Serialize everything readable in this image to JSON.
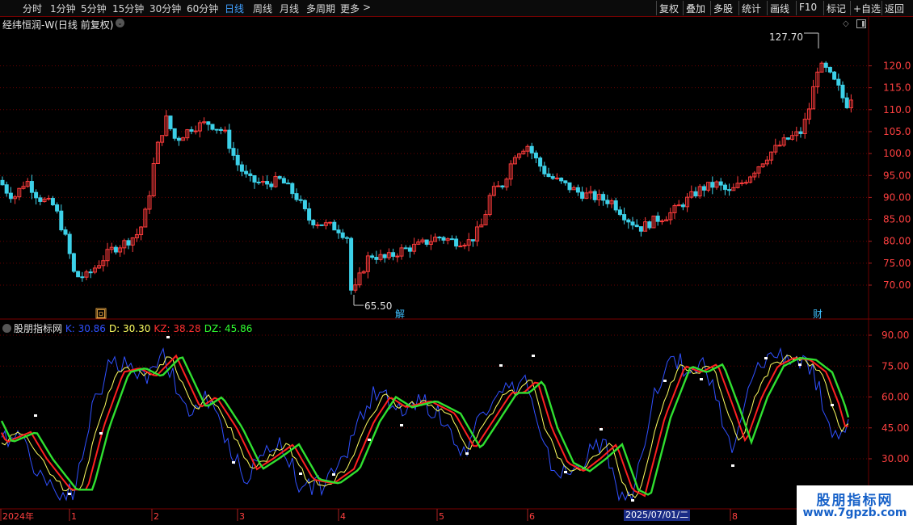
{
  "toolbar": {
    "periods": [
      "分时",
      "1分钟",
      "5分钟",
      "15分钟",
      "30分钟",
      "60分钟",
      "日线",
      "周线",
      "月线",
      "多周期",
      "更多"
    ],
    "active_period": "日线",
    "more_arrow": ">",
    "right_buttons": [
      "复权",
      "叠加",
      "多股",
      "统计",
      "画线",
      "F10",
      "标记",
      "+自选",
      "返回"
    ]
  },
  "main_chart": {
    "title": "经纬恒润-W(日线 前复权)",
    "price_ticks": [
      "120.0",
      "115.0",
      "110.0",
      "105.0",
      "100.0",
      "95.00",
      "90.00",
      "85.00",
      "80.00",
      "75.00",
      "70.00"
    ],
    "high_label": "127.70",
    "low_label": "65.50",
    "markers": [
      {
        "text": "回",
        "color": "#e0a040"
      },
      {
        "text": "解",
        "color": "#40c0ff"
      },
      {
        "text": "财",
        "color": "#40c0ff"
      }
    ]
  },
  "indicator": {
    "name": "股朋指标网",
    "values": [
      {
        "label": "K: 30.86",
        "color": "#3050ff"
      },
      {
        "label": "D: 30.30",
        "color": "#ffff60"
      },
      {
        "label": "KZ: 38.28",
        "color": "#ff3030"
      },
      {
        "label": "DZ: 45.86",
        "color": "#30ff30"
      }
    ],
    "ticks": [
      "90.00",
      "75.00",
      "60.00",
      "45.00",
      "30.00"
    ]
  },
  "time_axis": {
    "labels": [
      "2024年",
      "1",
      "2",
      "3",
      "4",
      "5",
      "6",
      "8"
    ],
    "cursor_date": "2025/07/01/二"
  },
  "watermark": {
    "line1": "股朋指标网",
    "line2": "www.7gpzb.com"
  },
  "colors": {
    "up": "#ff3c3c",
    "down": "#3cd0e8",
    "k": "#3050ff",
    "d": "#ffff60",
    "kz": "#ff2020",
    "dz": "#30e030",
    "grid": "#6a0000"
  }
}
